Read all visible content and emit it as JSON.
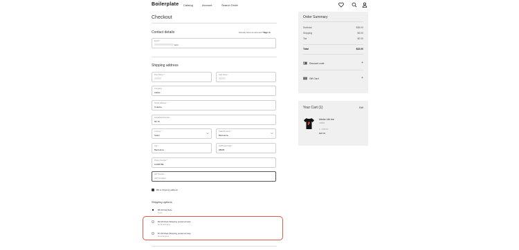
{
  "header": {
    "logo": "Boilerplate",
    "nav": [
      "Catalog",
      "Account",
      "Search Order"
    ],
    "icons": [
      "heart-icon",
      "search-icon",
      "user-icon"
    ]
  },
  "checkout": {
    "title": "Checkout",
    "contact": {
      "heading": "Contact details",
      "signin_prompt": "Already have an account?",
      "signin_link": "Sign in",
      "email_label": "Email *",
      "email_value": ".com"
    },
    "shipping": {
      "heading": "Shipping address",
      "first_name_label": "First Name *",
      "last_name_label": "Last Name *",
      "company_label": "Company",
      "company_value": "Adobe",
      "street_label": "Street Address *",
      "street_value": "Coletine",
      "house_label": "House/Flat Number",
      "house_value": "56-79",
      "country_label": "Country *",
      "country_value": "Spain",
      "state_label": "State/Province *",
      "state_value": "Barcelona",
      "city_label": "City *",
      "city_value": "Barcelona",
      "zip_label": "Zip/Postal Code *",
      "zip_value": "08005",
      "phone_label": "Phone Number *",
      "phone_value": "12456789",
      "vat_label": "VAT Number",
      "vat_value": "VAT Number"
    },
    "bill_to_shipping": "Bill to shipping address",
    "shipping_options": {
      "heading": "Shipping options",
      "options": [
        {
          "name": "$5.00 Flat Rate",
          "sub": "Fixed",
          "selected": true
        },
        {
          "name": "$3.99 Mock Shipping (external rate)",
          "sub": "Mock Standard",
          "selected": false
        },
        {
          "name": "$7.99 Mock Shipping (external rate)",
          "sub": "Mock Express",
          "selected": false
        }
      ]
    }
  },
  "summary": {
    "title": "Order Summary",
    "rows": [
      {
        "label": "Subtotal",
        "value": "$38.00"
      },
      {
        "label": "Shipping",
        "value": "$5.00"
      },
      {
        "label": "Tax",
        "value": "$0.00"
      }
    ],
    "total_label": "Total",
    "total_value": "$33.00",
    "discount_label": "Discount code",
    "gift_label": "Gift Card"
  },
  "cart": {
    "title": "Your Cart (1)",
    "edit": "Edit",
    "item": {
      "name": "Adobe Life tee",
      "sku": "ADB23",
      "qty_price": "1 × $38.00",
      "price": "$38.00"
    }
  },
  "colors": {
    "highlight": "#e05a44",
    "panel": "#f0f0f0"
  }
}
